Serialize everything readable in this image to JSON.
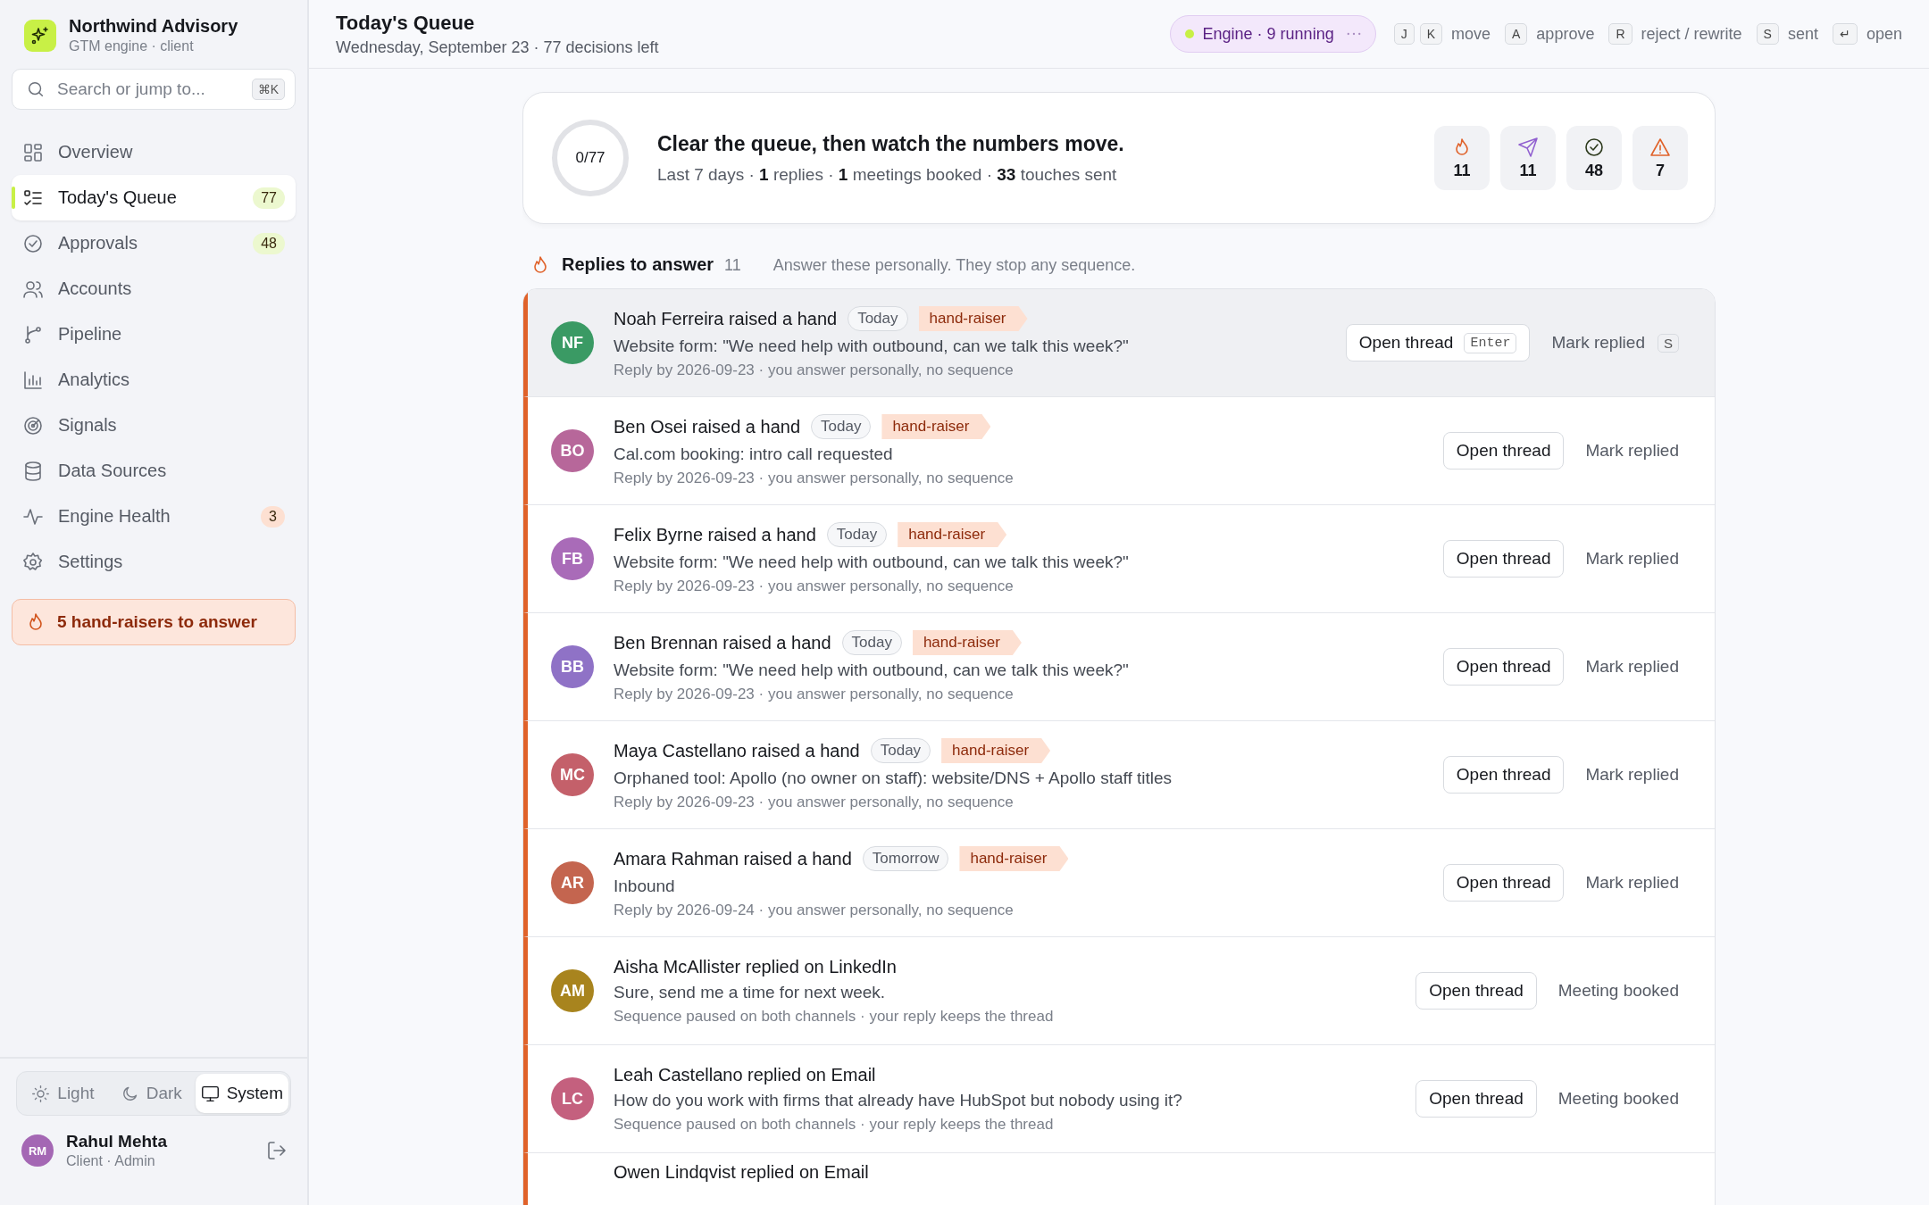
{
  "sidebar": {
    "brand": {
      "name": "Northwind Advisory",
      "subtitle": "GTM engine · client"
    },
    "search": {
      "placeholder": "Search or jump to...",
      "shortcut": "⌘K"
    },
    "nav": [
      {
        "label": "Overview",
        "selected": false
      },
      {
        "label": "Today's Queue",
        "badge": "77",
        "color": "#ecf8cf",
        "selected": true
      },
      {
        "label": "Approvals",
        "badge": "48",
        "color": "#ecf8cf",
        "selected": false
      },
      {
        "label": "Accounts",
        "selected": false
      },
      {
        "label": "Pipeline",
        "selected": false
      },
      {
        "label": "Analytics",
        "selected": false
      },
      {
        "label": "Signals",
        "selected": false
      },
      {
        "label": "Data Sources",
        "selected": false
      },
      {
        "label": "Engine Health",
        "badge": "3",
        "color": "#fde0d2",
        "selected": false
      },
      {
        "label": "Settings",
        "selected": false
      }
    ],
    "alert": "5 hand-raisers to answer",
    "themes": [
      {
        "label": "Light",
        "selected": false
      },
      {
        "label": "Dark",
        "selected": false
      },
      {
        "label": "System",
        "selected": true
      }
    ],
    "user": {
      "initials": "RM",
      "name": "Rahul Mehta",
      "role": "Client · Admin"
    }
  },
  "header": {
    "title": "Today's Queue",
    "subtitle": "Wednesday, September 23 · 77 decisions left",
    "engine": "Engine · 9 running",
    "shortcuts": [
      {
        "keys": [
          "J",
          "K"
        ],
        "label": "move"
      },
      {
        "keys": [
          "A"
        ],
        "label": "approve"
      },
      {
        "keys": [
          "R"
        ],
        "label": "reject / rewrite"
      },
      {
        "keys": [
          "S"
        ],
        "label": "sent"
      },
      {
        "keys": [
          "↵"
        ],
        "label": "open"
      }
    ]
  },
  "summary": {
    "progress": "0/77",
    "level": 0,
    "headline": "Clear the queue, then watch the numbers move.",
    "stats": "Last 7 days · **1** replies · **1** meetings booked · **33** touches sent",
    "metrics": [
      {
        "kind": "flame",
        "value": "11"
      },
      {
        "kind": "send",
        "value": "11"
      },
      {
        "kind": "check",
        "value": "48"
      },
      {
        "kind": "warning",
        "value": "7"
      }
    ]
  },
  "section": {
    "title": "Replies to answer",
    "count": "11",
    "note": "Answer these personally. They stop any sequence."
  },
  "items": [
    {
      "initials": "NF",
      "color": "#3a9a64",
      "title": "Noah Ferreira raised a hand",
      "when": "Today",
      "tag": "hand-raiser",
      "body": "Website form: \"We need help with outbound, can we talk this week?\"",
      "meta": "Reply by 2026-09-23 · you answer personally, no sequence",
      "primary": "Open thread",
      "primary_key": "Enter",
      "secondary": "Mark replied",
      "secondary_key": "S",
      "selected": true
    },
    {
      "initials": "BO",
      "color": "#b7679a",
      "title": "Ben Osei raised a hand",
      "when": "Today",
      "tag": "hand-raiser",
      "body": "Cal.com booking: intro call requested",
      "meta": "Reply by 2026-09-23 · you answer personally, no sequence",
      "primary": "Open thread",
      "secondary": "Mark replied",
      "selected": false
    },
    {
      "initials": "FB",
      "color": "#a96bb8",
      "title": "Felix Byrne raised a hand",
      "when": "Today",
      "tag": "hand-raiser",
      "body": "Website form: \"We need help with outbound, can we talk this week?\"",
      "meta": "Reply by 2026-09-23 · you answer personally, no sequence",
      "primary": "Open thread",
      "secondary": "Mark replied",
      "selected": false
    },
    {
      "initials": "BB",
      "color": "#8f72c6",
      "title": "Ben Brennan raised a hand",
      "when": "Today",
      "tag": "hand-raiser",
      "body": "Website form: \"We need help with outbound, can we talk this week?\"",
      "meta": "Reply by 2026-09-23 · you answer personally, no sequence",
      "primary": "Open thread",
      "secondary": "Mark replied",
      "selected": false
    },
    {
      "initials": "MC",
      "color": "#c4606a",
      "title": "Maya Castellano raised a hand",
      "when": "Today",
      "tag": "hand-raiser",
      "body": "Orphaned tool: Apollo (no owner on staff): website/DNS + Apollo staff titles",
      "meta": "Reply by 2026-09-23 · you answer personally, no sequence",
      "primary": "Open thread",
      "secondary": "Mark replied",
      "selected": false
    },
    {
      "initials": "AR",
      "color": "#c4654f",
      "title": "Amara Rahman raised a hand",
      "when": "Tomorrow",
      "tag": "hand-raiser",
      "body": "Inbound",
      "meta": "Reply by 2026-09-24 · you answer personally, no sequence",
      "primary": "Open thread",
      "secondary": "Mark replied",
      "selected": false
    },
    {
      "initials": "AM",
      "color": "#a8841e",
      "title": "Aisha McAllister replied on LinkedIn",
      "body": "Sure, send me a time for next week.",
      "meta": "Sequence paused on both channels · your reply keeps the thread",
      "primary": "Open thread",
      "secondary": "Meeting booked",
      "selected": false
    },
    {
      "initials": "LC",
      "color": "#c4607e",
      "title": "Leah Castellano replied on Email",
      "body": "How do you work with firms that already have HubSpot but nobody using it?",
      "meta": "Sequence paused on both channels · your reply keeps the thread",
      "primary": "Open thread",
      "secondary": "Meeting booked",
      "selected": false
    },
    {
      "title": "Owen Lindqvist replied on Email",
      "selected": false
    }
  ]
}
